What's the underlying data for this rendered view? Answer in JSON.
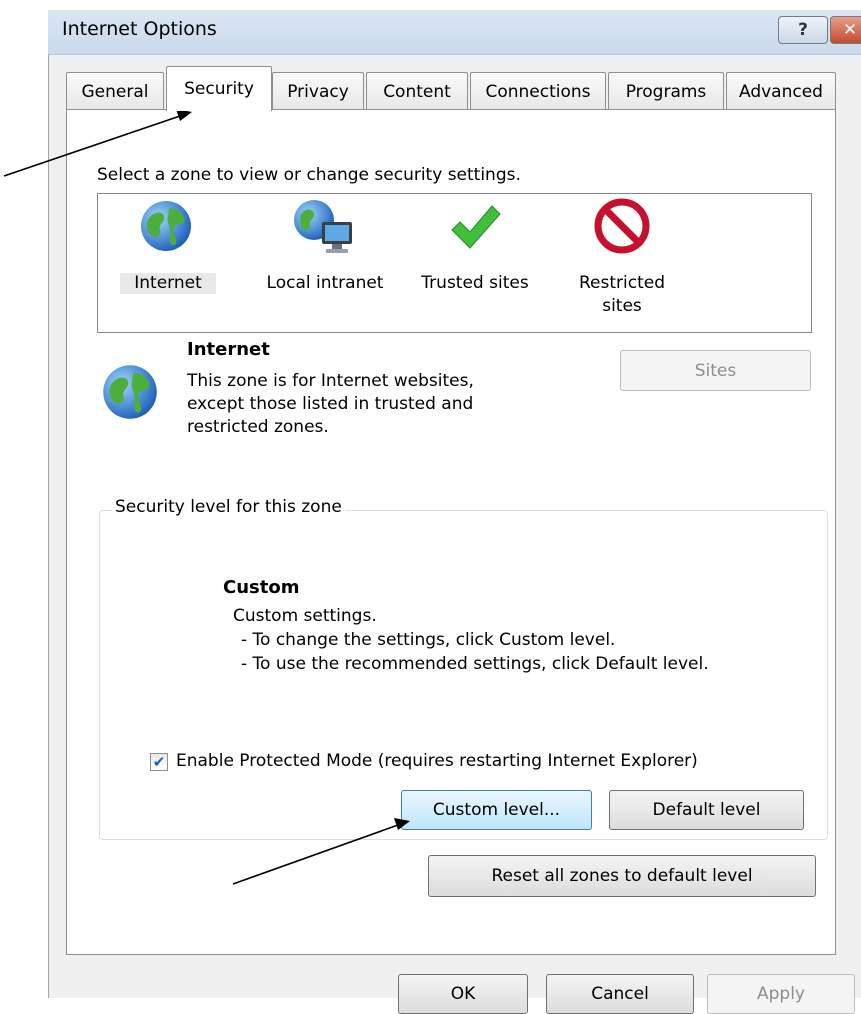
{
  "window": {
    "title": "Internet Options",
    "help_glyph": "?",
    "close_glyph": "✕"
  },
  "tabs": [
    "General",
    "Security",
    "Privacy",
    "Content",
    "Connections",
    "Programs",
    "Advanced"
  ],
  "active_tab": "Security",
  "zone_prompt": "Select a zone to view or change security settings.",
  "zones": [
    {
      "label": "Internet",
      "icon": "globe-icon"
    },
    {
      "label": "Local intranet",
      "icon": "intranet-icon"
    },
    {
      "label": "Trusted sites",
      "icon": "checkmark-icon"
    },
    {
      "label": "Restricted sites",
      "line1": "Restricted",
      "line2": "sites",
      "icon": "no-entry-icon"
    }
  ],
  "selected_zone": {
    "name": "Internet",
    "line1": "This zone is for Internet websites,",
    "line2": "except those listed in trusted and",
    "line3": "restricted zones."
  },
  "sites_button": "Sites",
  "security_level": {
    "legend": "Security level for this zone",
    "level_name": "Custom",
    "desc1": "Custom settings.",
    "desc2": "- To change the settings, click Custom level.",
    "desc3": "- To use the recommended settings, click Default level.",
    "protected_mode_label": "Enable Protected Mode (requires restarting Internet Explorer)",
    "protected_mode_checked": true,
    "custom_level_button": "Custom level...",
    "default_level_button": "Default level"
  },
  "reset_button": "Reset all zones to default level",
  "dialog_buttons": {
    "ok": "OK",
    "cancel": "Cancel",
    "apply": "Apply"
  },
  "colors": {
    "arrow": "#000000",
    "accent": "#3c7fb1"
  }
}
